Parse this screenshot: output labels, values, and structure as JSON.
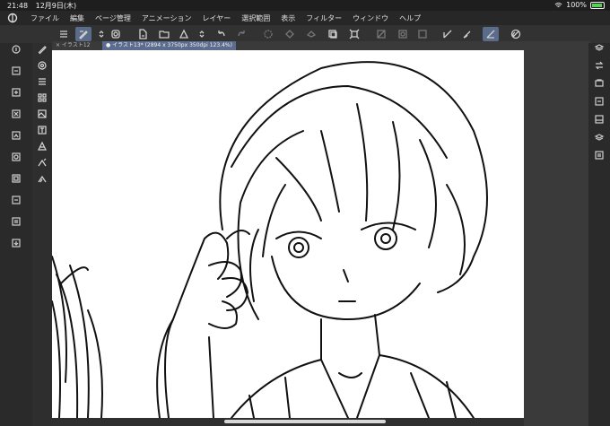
{
  "status": {
    "time": "21:48",
    "date": "12月9日(木)",
    "battery": "100%"
  },
  "menu": {
    "items": [
      "ファイル",
      "編集",
      "ページ管理",
      "アニメーション",
      "レイヤー",
      "選択範囲",
      "表示",
      "フィルター",
      "ウィンドウ",
      "ヘルプ"
    ]
  },
  "tabs": [
    {
      "label": "× イラスト12"
    },
    {
      "label": "● イラスト13* (2894 x 3750px 350dpi 123.4%)"
    }
  ],
  "colors": {
    "accent": "#5c6c8e",
    "canvas": "#ffffff",
    "ui_dark": "#2b2b2b"
  },
  "icons": {
    "toolbar": [
      "menu-icon",
      "brush-tool-icon",
      "stepper-icon",
      "brush-size-icon",
      "new-file-icon",
      "open-folder-icon",
      "save-icon",
      "stepper-icon",
      "undo-icon",
      "redo-icon",
      "clear-icon",
      "fill-icon",
      "transform-icon",
      "move-layer-icon",
      "layer-icon",
      "selection-icon",
      "mask-icon",
      "ruler-icon",
      "line-icon",
      "pen-icon",
      "brush-stroke-icon",
      "settings-icon"
    ],
    "leftrail": [
      "home-icon",
      "layer-copy-icon",
      "layer-icon",
      "delete-icon",
      "reference-icon",
      "mask-icon",
      "frame-icon",
      "folder-icon",
      "print-icon",
      "export-icon"
    ],
    "toolcol": [
      "pen-tool-icon",
      "circle-tool-icon",
      "list-tool-icon",
      "grid-tool-icon",
      "image-tool-icon",
      "text-tool-icon",
      "fill-tool-icon",
      "eraser-tool-icon",
      "blend-tool-icon"
    ],
    "rightrail": [
      "layers-icon",
      "transfer-icon",
      "navigator-icon",
      "material-icon",
      "property-icon",
      "stack-icon",
      "history-icon"
    ]
  }
}
